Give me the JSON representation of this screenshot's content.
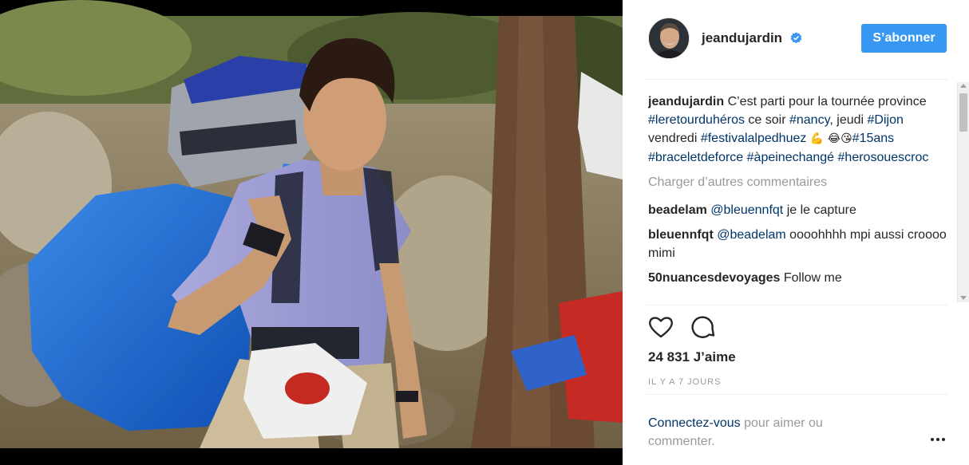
{
  "post": {
    "username": "jeandujardin",
    "verified": true,
    "follow_label": "S’abonner"
  },
  "caption": {
    "username": "jeandujardin",
    "text_1": " C’est parti pour la tournée province ",
    "tag_1": "#leretourduhéros",
    "text_2": " ce soir ",
    "tag_2": "#nancy",
    "text_3": ", jeudi ",
    "tag_3": "#Dijon",
    "text_4": " vendredi ",
    "tag_4": "#festivalalpedhuez",
    "emoji_1": " 💪 ",
    "emoji_2": "😂😘",
    "tag_5": "#15ans",
    "tag_6": "#braceletdeforce",
    "tag_7": "#àpeinechangé",
    "tag_8": "#herosouescroc"
  },
  "load_more_label": "Charger d’autres commentaires",
  "comments": [
    {
      "user": "beadelam",
      "mention": "@bleuennfqt",
      "text": " je le capture"
    },
    {
      "user": "bleuennfqt",
      "mention": "@beadelam",
      "text": " oooohhhh mpi aussi croooo mimi"
    },
    {
      "user": "50nuancesdevoyages",
      "mention": "",
      "text": " Follow me"
    }
  ],
  "likes": {
    "count": "24 831",
    "label": " J’aime"
  },
  "timestamp": "IL Y A 7 JOURS",
  "login_prompt": {
    "link": "Connectez-vous",
    "text": " pour aimer ou commenter."
  },
  "icons": {
    "like": "heart-icon",
    "comment": "comment-icon",
    "more": "more-options-icon",
    "verified": "verified-badge-icon"
  },
  "colors": {
    "accent": "#3897f0",
    "link": "#003569",
    "muted": "#999999",
    "text": "#262626"
  }
}
